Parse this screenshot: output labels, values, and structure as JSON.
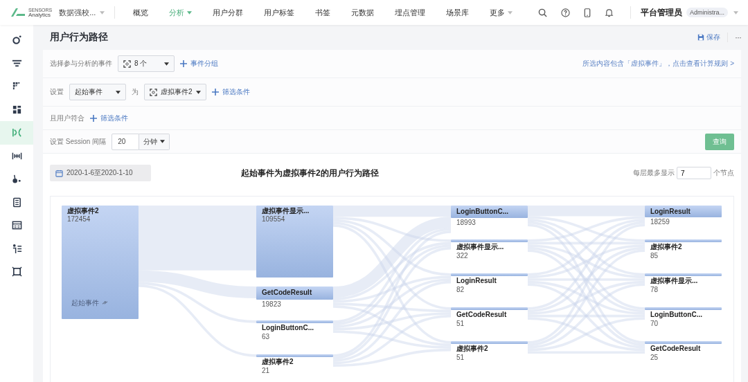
{
  "top_nav": {
    "logo_line1": "SENSORS",
    "logo_line2": "Analytics",
    "project": "数据强校...",
    "items": [
      {
        "label": "概览",
        "selected": false,
        "dropdown": false
      },
      {
        "label": "分析",
        "selected": true,
        "dropdown": true
      },
      {
        "label": "用户分群",
        "selected": false,
        "dropdown": false
      },
      {
        "label": "用户标签",
        "selected": false,
        "dropdown": false
      },
      {
        "label": "书签",
        "selected": false,
        "dropdown": false
      },
      {
        "label": "元数据",
        "selected": false,
        "dropdown": false
      },
      {
        "label": "埋点管理",
        "selected": false,
        "dropdown": false
      },
      {
        "label": "场景库",
        "selected": false,
        "dropdown": false
      },
      {
        "label": "更多",
        "selected": false,
        "dropdown": true
      }
    ],
    "user_name": "平台管理员",
    "user_role": "Administra..."
  },
  "sidebar": {
    "items": [
      {
        "kind": "overview",
        "selected": false
      },
      {
        "kind": "funnel",
        "selected": false
      },
      {
        "kind": "retention",
        "selected": false
      },
      {
        "kind": "distribution",
        "selected": false
      },
      {
        "kind": "path",
        "selected": true
      },
      {
        "kind": "interval",
        "selected": false
      },
      {
        "kind": "attribution",
        "selected": false
      },
      {
        "kind": "report",
        "selected": false
      },
      {
        "kind": "table",
        "selected": false
      },
      {
        "kind": "users",
        "selected": false
      },
      {
        "kind": "tools",
        "selected": false
      }
    ]
  },
  "page": {
    "title": "用户行为路径",
    "save": "保存",
    "more": "···"
  },
  "filters": {
    "events_label": "选择参与分析的事件",
    "events_value": "8 个",
    "group_link": "事件分组",
    "notice": "所选内容包含「虚拟事件」，点击查看计算规则 >",
    "set_label": "设置",
    "start_type": "起始事件",
    "as_label": "为",
    "start_event": "虚拟事件2",
    "event_filter_link": "筛选条件",
    "user_label": "且用户符合",
    "user_filter_link": "筛选条件",
    "session_label": "设置 Session 间隔",
    "session_value": "20",
    "session_unit": "分钟",
    "query_button": "查询"
  },
  "chart_header": {
    "date_range": "2020-1-6至2020-1-10",
    "title": "起始事件为虚拟事件2的用户行为路径",
    "per_layer_label": "每层最多显示",
    "per_layer_value": "7",
    "per_layer_unit": "个节点"
  },
  "path_chart": {
    "start_label": "起始事件",
    "columns": [
      {
        "nodes": [
          {
            "name": "虚拟事件2",
            "count": "172454"
          }
        ]
      },
      {
        "nodes": [
          {
            "name": "虚拟事件显示...",
            "count": "109554"
          },
          {
            "name": "GetCodeResult",
            "count": "19823"
          },
          {
            "name": "LoginButtonC...",
            "count": "63"
          },
          {
            "name": "虚拟事件2",
            "count": "21"
          }
        ]
      },
      {
        "nodes": [
          {
            "name": "LoginButtonC...",
            "count": "18993"
          },
          {
            "name": "虚拟事件显示...",
            "count": "322"
          },
          {
            "name": "LoginResult",
            "count": "82"
          },
          {
            "name": "GetCodeResult",
            "count": "51"
          },
          {
            "name": "虚拟事件2",
            "count": "51"
          }
        ]
      },
      {
        "nodes": [
          {
            "name": "LoginResult",
            "count": "18259"
          },
          {
            "name": "虚拟事件2",
            "count": "85"
          },
          {
            "name": "虚拟事件显示...",
            "count": "78"
          },
          {
            "name": "LoginButtonC...",
            "count": "70"
          },
          {
            "name": "GetCodeResult",
            "count": "25"
          }
        ]
      }
    ]
  }
}
